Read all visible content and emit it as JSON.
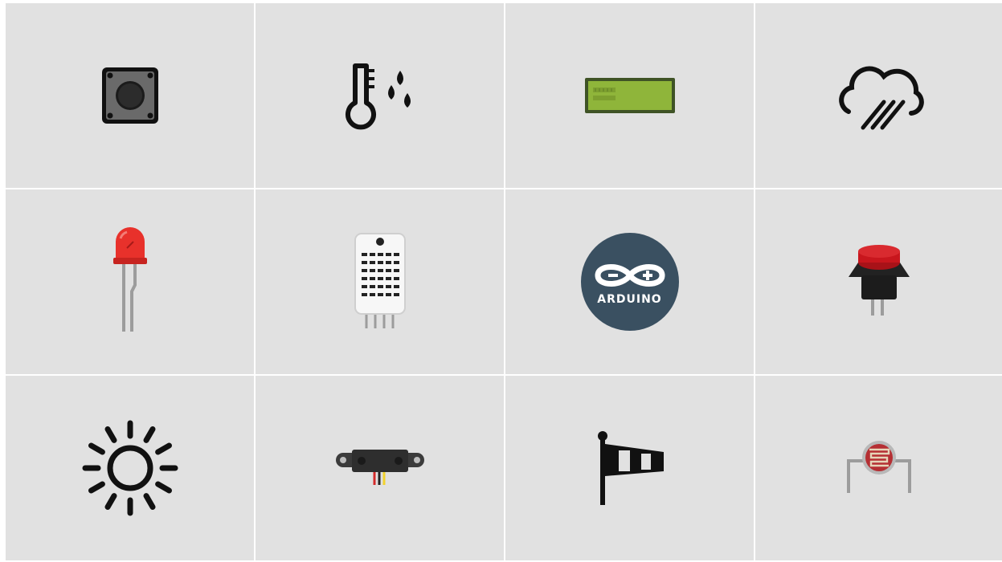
{
  "tiles": [
    {
      "icon": "tactile-push-button-icon"
    },
    {
      "icon": "temperature-humidity-icon"
    },
    {
      "icon": "lcd-display-icon"
    },
    {
      "icon": "rain-cloud-icon"
    },
    {
      "icon": "red-led-icon"
    },
    {
      "icon": "dht-sensor-icon"
    },
    {
      "icon": "arduino-logo-icon",
      "logo_text": "ARDUINO"
    },
    {
      "icon": "red-push-button-icon"
    },
    {
      "icon": "sun-icon"
    },
    {
      "icon": "ir-distance-sensor-icon"
    },
    {
      "icon": "windsock-icon"
    },
    {
      "icon": "photoresistor-icon"
    }
  ],
  "colors": {
    "tile_background": "#e1e1e1",
    "grid_lines": "#ffffff",
    "icon_black": "#111111",
    "led_red": "#e8312b",
    "lcd_green": "#8fb53a",
    "arduino_blue": "#3a5061",
    "button_red": "#c8161d"
  }
}
